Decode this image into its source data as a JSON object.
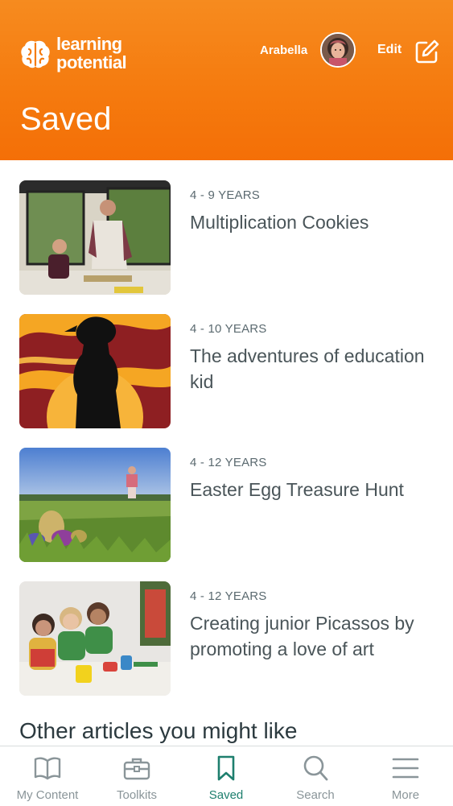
{
  "header": {
    "logo_line1": "learning",
    "logo_line2": "potential",
    "user_name": "Arabella",
    "edit_label": "Edit",
    "page_title": "Saved"
  },
  "articles": [
    {
      "age": "4 - 9 YEARS",
      "title": "Multiplication Cookies"
    },
    {
      "age": "4 - 10 YEARS",
      "title": "The adventures of education kid"
    },
    {
      "age": "4 - 12 YEARS",
      "title": "Easter Egg Treasure Hunt"
    },
    {
      "age": "4 - 12 YEARS",
      "title": "Creating junior Picassos by promoting a love of art"
    }
  ],
  "other_heading": "Other articles you might like",
  "tabs": [
    {
      "label": "My Content",
      "icon": "book-open-icon"
    },
    {
      "label": "Toolkits",
      "icon": "toolbox-icon"
    },
    {
      "label": "Saved",
      "icon": "bookmark-icon",
      "active": true
    },
    {
      "label": "Search",
      "icon": "search-icon"
    },
    {
      "label": "More",
      "icon": "menu-icon"
    }
  ],
  "colors": {
    "header_orange": "#f57b0f",
    "active_tab": "#1e7f6e",
    "inactive_tab": "#8a9599"
  }
}
